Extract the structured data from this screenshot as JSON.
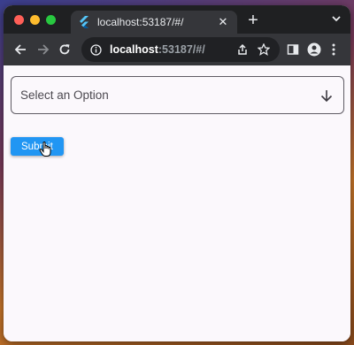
{
  "browser": {
    "tab_title": "localhost:53187/#/",
    "tab_close": "✕",
    "new_tab": "+",
    "url_host": "localhost",
    "url_rest": ":53187/#/"
  },
  "form": {
    "select_placeholder": "Select an Option",
    "submit_label": "Submit"
  },
  "colors": {
    "accent": "#2196f3",
    "chrome_dark": "#35363a"
  }
}
